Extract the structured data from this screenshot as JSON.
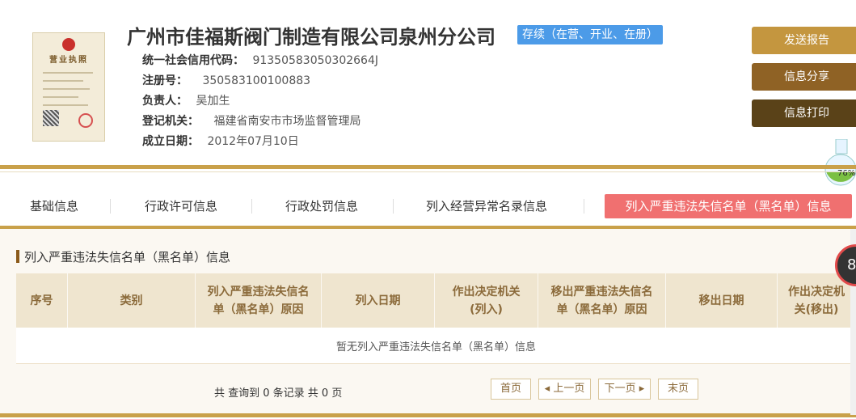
{
  "company": {
    "name": "广州市佳福斯阀门制造有限公司泉州分公司",
    "status": "存续（在营、开业、在册）",
    "license_title": "营业执照",
    "fields": [
      {
        "label": "统一社会信用代码：",
        "value": "91350583050302664J"
      },
      {
        "label": "注册号：",
        "value": "350583100100883"
      },
      {
        "label": "负责人：",
        "value": "吴加生"
      },
      {
        "label": "登记机关：",
        "value": "福建省南安市市场监督管理局"
      },
      {
        "label": "成立日期：",
        "value": "2012年07月10日"
      }
    ]
  },
  "actions": {
    "report": "发送报告",
    "share": "信息分享",
    "print": "信息打印"
  },
  "widget": {
    "flask_percent": "76%",
    "circle_text": "8"
  },
  "tabs": [
    {
      "label": "基础信息"
    },
    {
      "label": "行政许可信息"
    },
    {
      "label": "行政处罚信息"
    },
    {
      "label": "列入经营异常名录信息"
    },
    {
      "label": "列入严重违法失信名单（黑名单）信息",
      "active": true
    }
  ],
  "section": {
    "title": "列入严重违法失信名单（黑名单）信息",
    "columns": [
      "序号",
      "类别",
      "列入严重违法失信名单（黑名单）原因",
      "列入日期",
      "作出决定机关(列入)",
      "移出严重违法失信名单（黑名单）原因",
      "移出日期",
      "作出决定机关(移出)"
    ],
    "empty_text": "暂无列入严重违法失信名单（黑名单）信息"
  },
  "pager": {
    "summary": "共 查询到 0 条记录 共 0 页",
    "first": "首页",
    "prev": "◂ 上一页",
    "next": "下一页 ▸",
    "last": "末页"
  },
  "colors": {
    "gold": "#c9a14a",
    "active_tab": "#f07070",
    "status_badge": "#4c9be8"
  }
}
